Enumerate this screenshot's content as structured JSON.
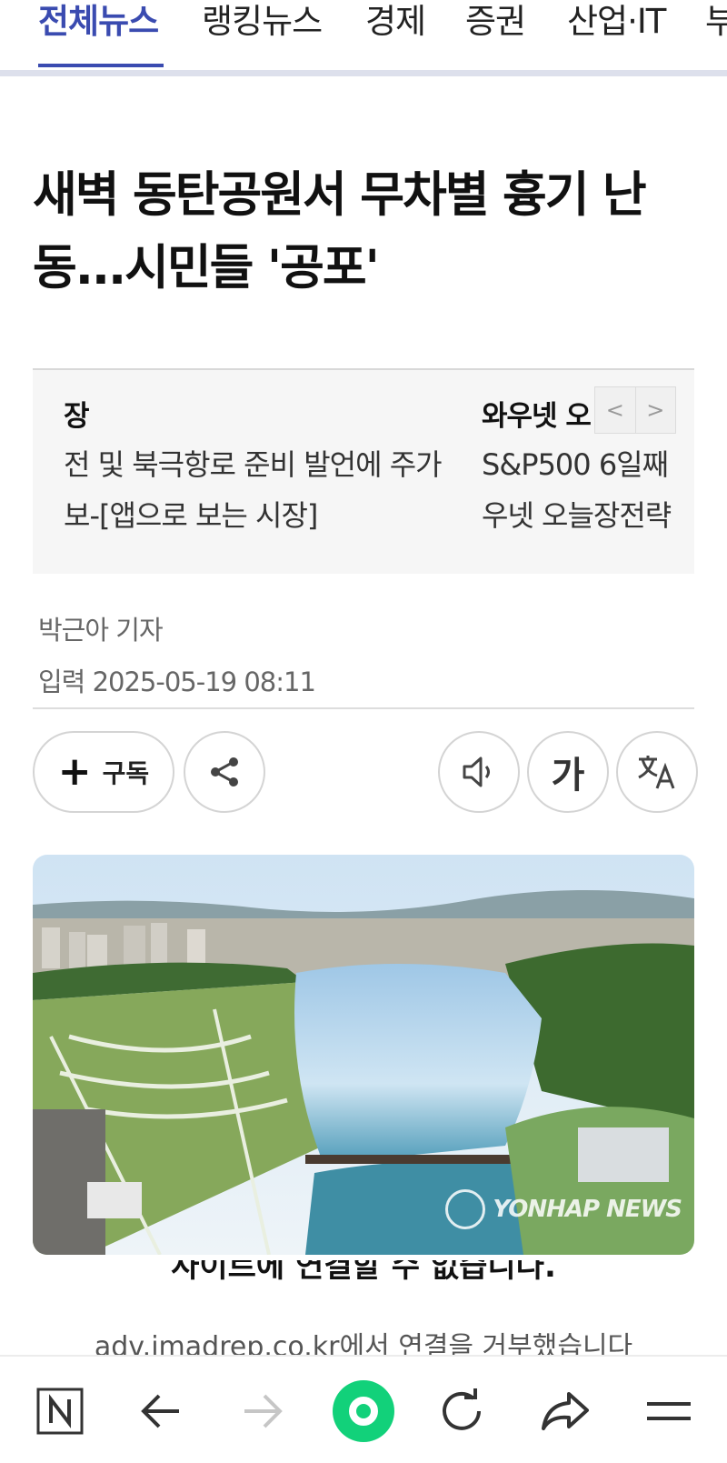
{
  "nav": {
    "tabs": [
      {
        "label": "전체뉴스",
        "active": true
      },
      {
        "label": "랭킹뉴스",
        "active": false
      },
      {
        "label": "경제",
        "active": false
      },
      {
        "label": "증권",
        "active": false
      },
      {
        "label": "산업·IT",
        "active": false
      },
      {
        "label": "부",
        "active": false
      }
    ]
  },
  "article": {
    "headline_line1": "새벽 동탄공원서 무차별 흉기 난",
    "headline_line2": "동...시민들 '공포'",
    "reporter": "박근아 기자",
    "dateline": "입력 2025-05-19 08:11"
  },
  "ticker": {
    "items": [
      {
        "title": "장",
        "line1": "전 및 북극항로 준비 발언에 주가",
        "line2": "보-[앱으로 보는 시장]"
      },
      {
        "title": "와우넷 오",
        "line1": "S&P500 6일째",
        "line2": "우넷 오늘장전략"
      }
    ],
    "prev_label": "<",
    "next_label": ">"
  },
  "actions": {
    "subscribe_plus": "+",
    "subscribe_label": "구독",
    "font_size_label": "가"
  },
  "photo": {
    "watermark": "YONHAP NEWS"
  },
  "overlay": {
    "cut_line1": "사이트에 연결할 수 없습니다.",
    "cut_line2": "adv.imadrep.co.kr에서 연결을 거부했습니다"
  },
  "icons": {
    "share": "share-icon",
    "speaker": "speaker-icon",
    "translate": "translate-icon",
    "n_home": "naver-n-icon",
    "back": "arrow-left-icon",
    "forward": "arrow-right-icon",
    "green": "green-circle-icon",
    "refresh": "refresh-icon",
    "share_bottom": "share-arrow-icon",
    "menu": "menu-icon"
  },
  "colors": {
    "accent": "#3a4bb0",
    "green": "#12d17a"
  }
}
